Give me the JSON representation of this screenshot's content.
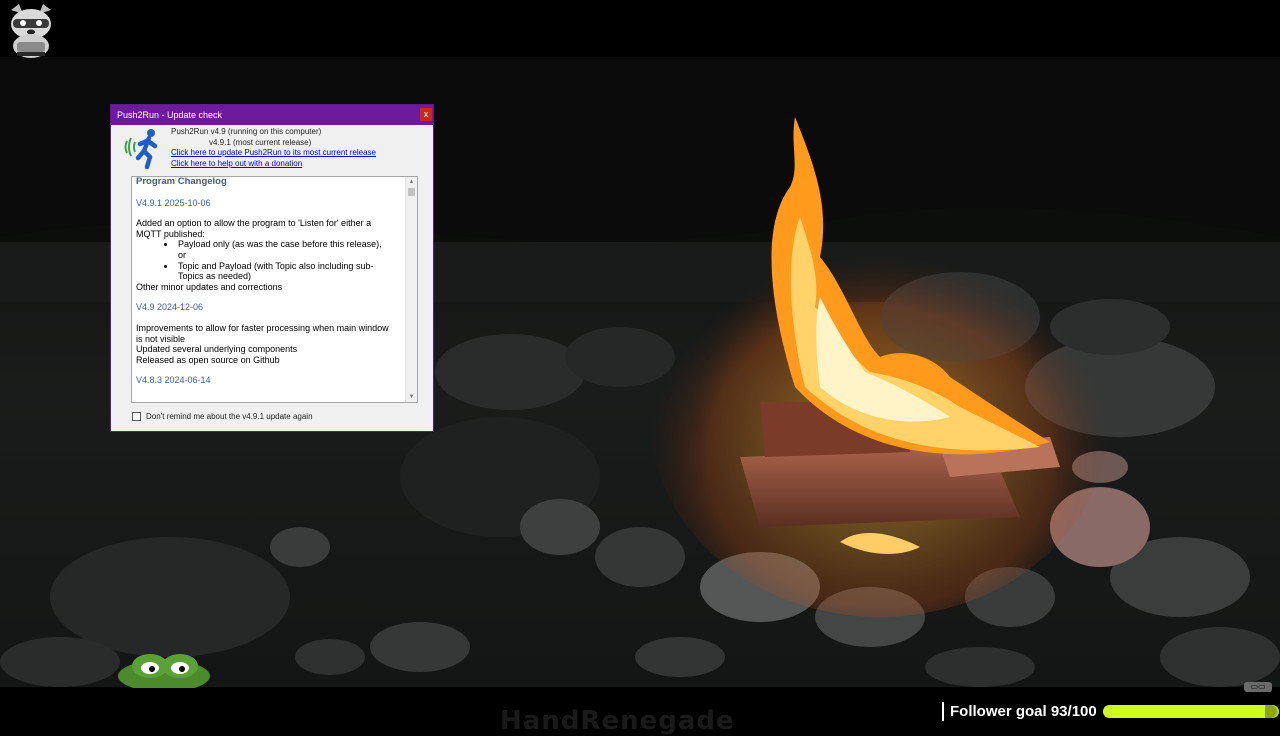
{
  "dialog": {
    "title": "Push2Run - Update check",
    "close_label": "x",
    "installed_version": "Push2Run v4.9 (running on this computer)",
    "current_version": "v4.9.1 (most current release)",
    "update_link": "Click here to update Push2Run to its most current release",
    "donate_link": "Click here to help out with a donation",
    "remind_label": "Don't remind me about the v4.9.1 update again",
    "remind_checked": false
  },
  "changelog": {
    "heading": "Program Changelog",
    "entries": [
      {
        "version": "V4.9.1 2025-10-06",
        "intro_1": "Added an option to allow the program to 'Listen for' either a",
        "intro_2": "MQTT published:",
        "bullet_1a": "Payload only (as was the case before this release),",
        "bullet_1b": "or",
        "bullet_2a": "Topic and Payload (with Topic also including sub-",
        "bullet_2b": "Topics as needed)",
        "outro": "Other minor updates and corrections"
      },
      {
        "version": "V4.9 2024-12-06",
        "line_1": "Improvements to allow for faster processing when main window",
        "line_2": "is not visible",
        "line_3": "Updated several underlying components",
        "line_4": "Released as open source on Github"
      },
      {
        "version": "V4.8.3 2024-06-14"
      }
    ]
  },
  "overlay": {
    "follower_text": "Follower goal 93/100",
    "follower_progress": 0.93,
    "watermark": "HandRenegade",
    "corner_badge": "▭▭"
  },
  "colors": {
    "titlebar": "#6d1a9c",
    "progress": "#ccff1a",
    "link": "#0000ee"
  }
}
